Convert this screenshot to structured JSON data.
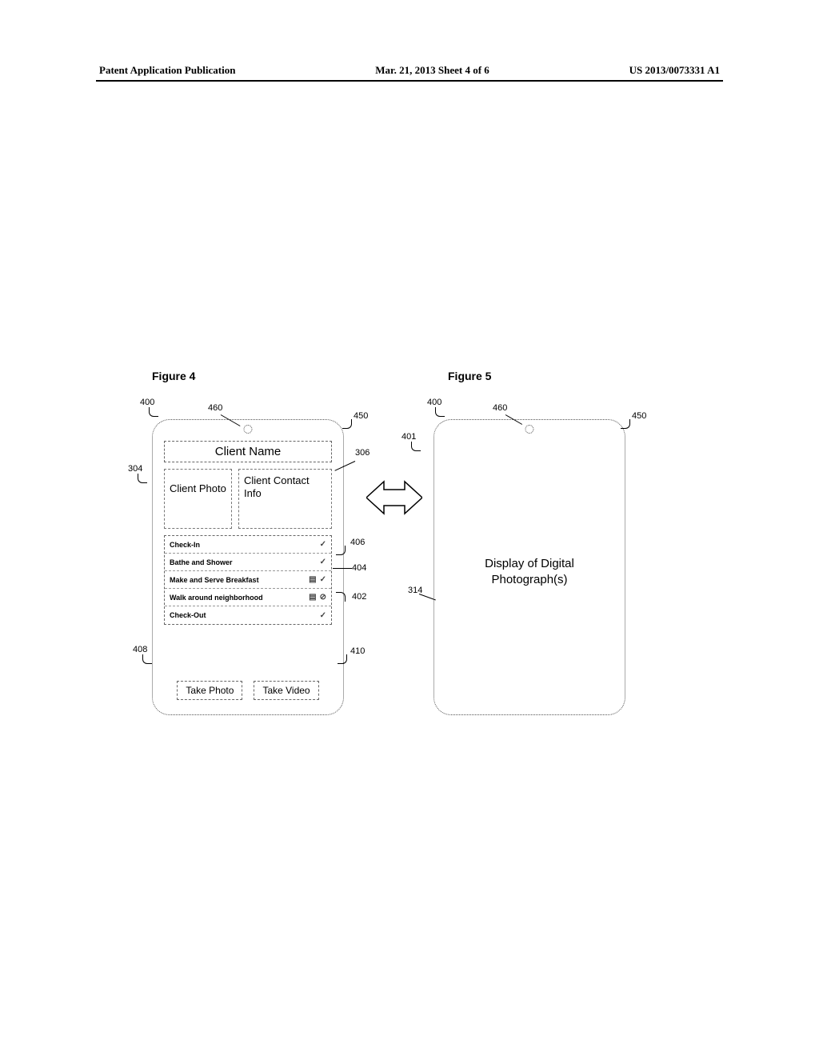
{
  "header": {
    "left": "Patent Application Publication",
    "center": "Mar. 21, 2013  Sheet 4 of 6",
    "right": "US 2013/0073331 A1"
  },
  "figure4": {
    "title": "Figure 4",
    "client_name": "Client Name",
    "client_photo": "Client Photo",
    "client_contact": "Client Contact Info",
    "tasks": {
      "t0": "Check-In",
      "t1": "Bathe and Shower",
      "t2": "Make and Serve Breakfast",
      "t3": "Walk around neighborhood",
      "t4": "Check-Out"
    },
    "take_photo": "Take Photo",
    "take_video": "Take Video"
  },
  "figure5": {
    "title": "Figure 5",
    "body": "Display of Digital Photograph(s)"
  },
  "callouts": {
    "c400a": "400",
    "c460a": "460",
    "c450a": "450",
    "c304": "304",
    "c306": "306",
    "c406": "406",
    "c404": "404",
    "c402": "402",
    "c408": "408",
    "c410": "410",
    "c400b": "400",
    "c460b": "460",
    "c450b": "450",
    "c401": "401",
    "c314": "314"
  }
}
